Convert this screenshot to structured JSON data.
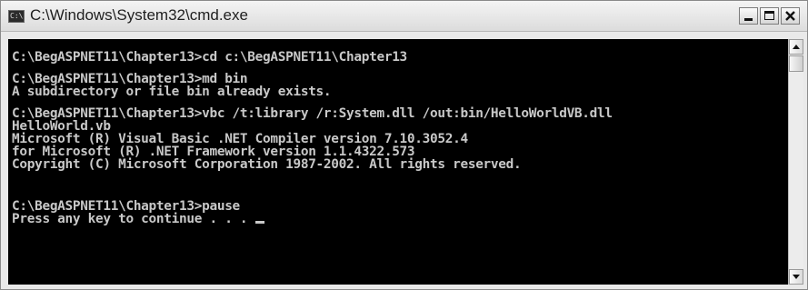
{
  "window": {
    "title": "C:\\Windows\\System32\\cmd.exe",
    "icon": "console-icon"
  },
  "console": {
    "lines": [
      "C:\\BegASPNET11\\Chapter13>cd c:\\BegASPNET11\\Chapter13",
      "C:\\BegASPNET11\\Chapter13>md bin",
      "A subdirectory or file bin already exists.",
      "C:\\BegASPNET11\\Chapter13>vbc /t:library /r:System.dll /out:bin/HelloWorldVB.dll",
      "HelloWorld.vb",
      "Microsoft (R) Visual Basic .NET Compiler version 7.10.3052.4",
      "for Microsoft (R) .NET Framework version 1.1.4322.573",
      "Copyright (C) Microsoft Corporation 1987-2002. All rights reserved.",
      "C:\\BegASPNET11\\Chapter13>pause",
      "Press any key to continue . . . "
    ]
  },
  "colors": {
    "console_background": "#000000",
    "console_text": "#c8c8c8",
    "titlebar": "#e9e9e9"
  }
}
